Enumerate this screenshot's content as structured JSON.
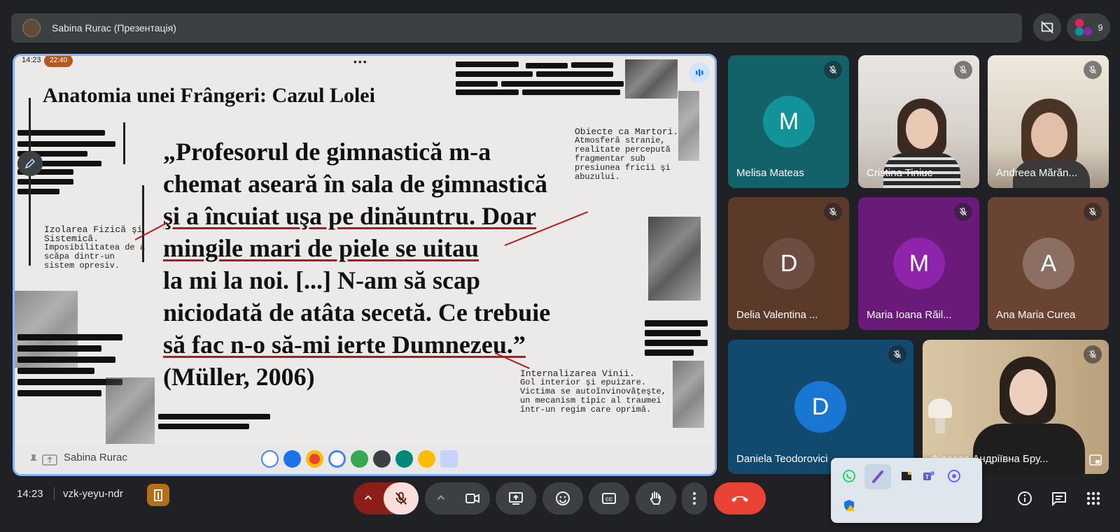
{
  "header": {
    "presenter_title": "Sabina Rurac (Презентація)",
    "participant_count": "9"
  },
  "slide": {
    "status_time": "14:23",
    "call_pill": "22:40",
    "title": "Anatomia unei Frângeri: Cazul Lolei",
    "quote_lines": [
      "„Profesorul de gimnastică m-a",
      "chemat aseară în sala de gimnastică",
      "şi a încuiat uşa pe dinăuntru. Doar",
      "mingile mari de piele se uitau",
      "la mi la noi. [...] N-am să scap",
      "niciodată de atâta secetă. Ce trebuie",
      "să fac n-o să-mi ierte Dumnezeu.”",
      "(Müller, 2006)"
    ],
    "note_right_top": {
      "heading": "Obiecte ca Martori.",
      "body": "Atmosferă stranie, realitate percepută fragmentar sub presiunea fricii şi abuzului."
    },
    "note_left": {
      "heading": "Izolarea Fizică şi Sistemică.",
      "body": "Imposibilitatea de a scăpa dintr-un sistem opresiv."
    },
    "note_right_bottom": {
      "heading": "Internalizarea Vinii.",
      "body": "Gol interior şi epuizare. Victima se autoînvinovăţeşte, un mecanism tipic al traumei într-un regim care oprimă."
    }
  },
  "presentation_footer": {
    "presenter_name": "Sabina Rurac"
  },
  "participants": [
    {
      "name": "Melisa Mateas",
      "initial": "M",
      "color": "#12939a",
      "bg": "#13626a",
      "camera": false
    },
    {
      "name": "Cristina Tiniuc",
      "initial": "",
      "color": "",
      "bg": "#cfc9c2",
      "camera": true
    },
    {
      "name": "Andreea Mărăn...",
      "initial": "",
      "color": "",
      "bg": "#d9d2c7",
      "camera": true
    },
    {
      "name": "Delia Valentina ...",
      "initial": "D",
      "color": "#6d4c41",
      "bg": "#5b3a2a",
      "camera": false
    },
    {
      "name": "Maria Ioana Răil...",
      "initial": "M",
      "color": "#8e24aa",
      "bg": "#6a1b7a",
      "camera": false
    },
    {
      "name": "Ana Maria Curea",
      "initial": "A",
      "color": "#8d6e63",
      "bg": "#6a4432",
      "camera": false
    },
    {
      "name": "Daniela Teodorovici",
      "initial": "D",
      "color": "#1976d2",
      "bg": "#114a6e",
      "camera": false
    },
    {
      "name": "Фірсова Андріївна Бру...",
      "initial": "",
      "color": "",
      "bg": "#c9b79a",
      "camera": true
    }
  ],
  "bottom_bar": {
    "clock": "14:23",
    "meeting_code": "vzk-yeyu-ndr"
  },
  "colors": {
    "accent": "#8ab4f8",
    "leave": "#ea4335",
    "mic_off_bg": "#f9dedc",
    "mic_group": "#8c1d18"
  },
  "icons": [
    "pen-icon",
    "visibility-off-icon",
    "people-icon",
    "mic-off-icon",
    "videocam-icon",
    "present-icon",
    "emoji-icon",
    "cc-icon",
    "hand-icon",
    "more-vert-icon",
    "call-end-icon",
    "info-icon",
    "chat-icon",
    "apps-icon",
    "whatsapp-icon",
    "teams-icon",
    "viber-icon"
  ]
}
